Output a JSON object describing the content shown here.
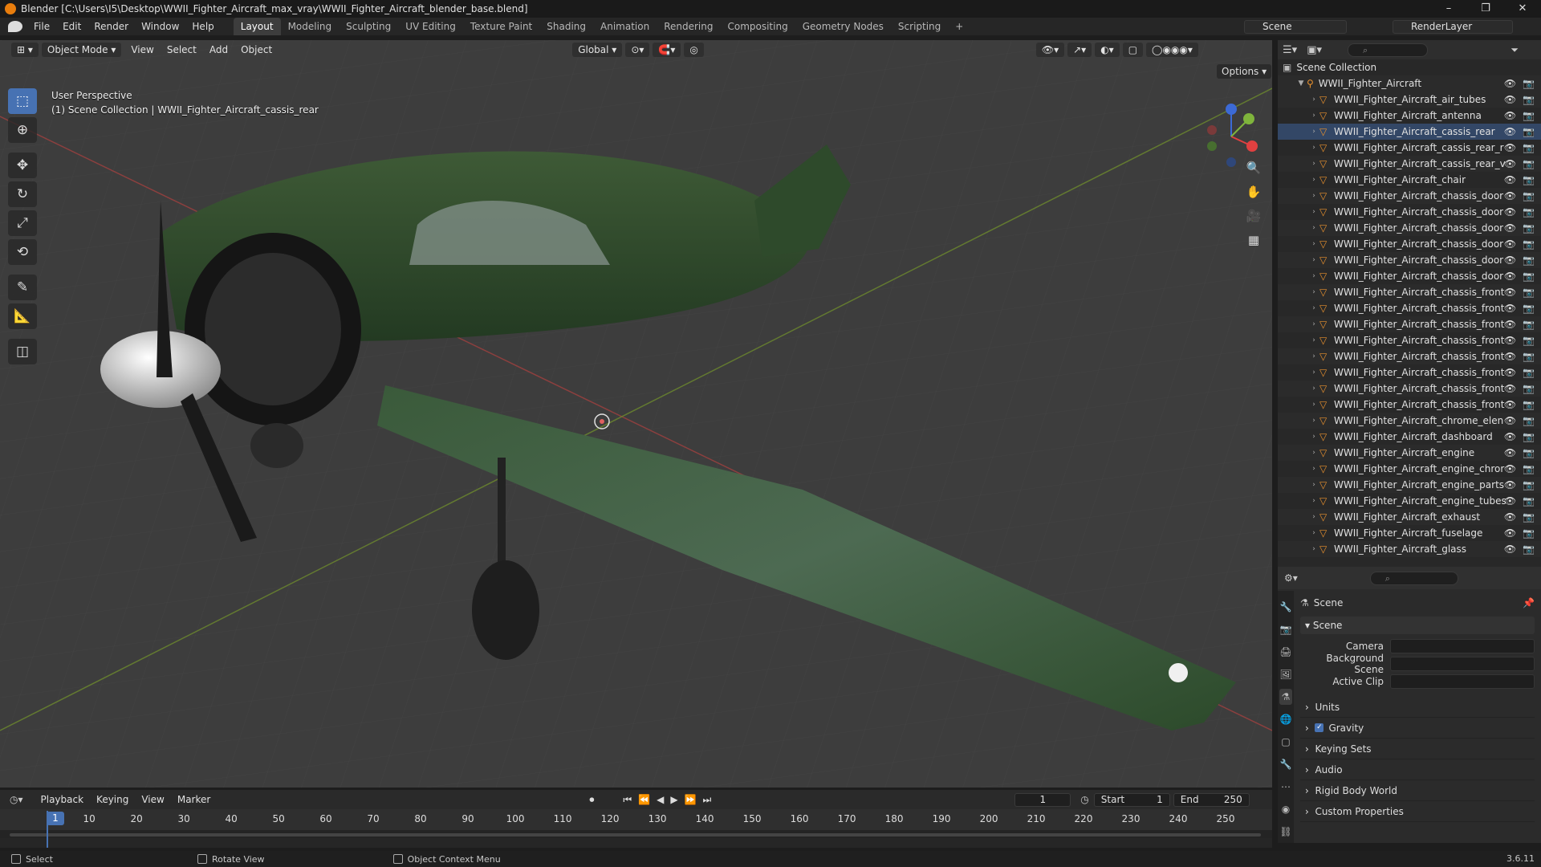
{
  "window": {
    "title": "Blender [C:\\Users\\I5\\Desktop\\WWII_Fighter_Aircraft_max_vray\\WWII_Fighter_Aircraft_blender_base.blend]",
    "minimize": "–",
    "maximize": "❐",
    "close": "✕"
  },
  "menu": {
    "items": [
      "File",
      "Edit",
      "Render",
      "Window",
      "Help"
    ],
    "workspaces": [
      "Layout",
      "Modeling",
      "Sculpting",
      "UV Editing",
      "Texture Paint",
      "Shading",
      "Animation",
      "Rendering",
      "Compositing",
      "Geometry Nodes",
      "Scripting"
    ],
    "add_tab": "+",
    "scene": "Scene",
    "render_layer": "RenderLayer"
  },
  "viewport_header": {
    "mode": "Object Mode",
    "menus": [
      "View",
      "Select",
      "Add",
      "Object"
    ],
    "transform_orientation": "Global",
    "options": "Options"
  },
  "viewport": {
    "perspective": "User Perspective",
    "collection_info": "(1) Scene Collection | WWII_Fighter_Aircraft_cassis_rear",
    "gizmo_axes": [
      "X",
      "Y",
      "Z"
    ]
  },
  "toolbar": {
    "tools": [
      {
        "name": "select-box-tool",
        "glyph": "⬚",
        "active": true
      },
      {
        "name": "cursor-tool",
        "glyph": "⊕",
        "active": false
      },
      {
        "name": "move-tool",
        "glyph": "✥",
        "active": false
      },
      {
        "name": "rotate-tool",
        "glyph": "↻",
        "active": false
      },
      {
        "name": "scale-tool",
        "glyph": "⤢",
        "active": false
      },
      {
        "name": "transform-tool",
        "glyph": "⟲",
        "active": false
      },
      {
        "name": "annotate-tool",
        "glyph": "✎",
        "active": false
      },
      {
        "name": "measure-tool",
        "glyph": "📐",
        "active": false
      },
      {
        "name": "add-cube-tool",
        "glyph": "◫",
        "active": false
      }
    ]
  },
  "outliner": {
    "root": "Scene Collection",
    "collection": "WWII_Fighter_Aircraft",
    "items": [
      "WWII_Fighter_Aircraft_air_tubes",
      "WWII_Fighter_Aircraft_antenna",
      "WWII_Fighter_Aircraft_cassis_rear",
      "WWII_Fighter_Aircraft_cassis_rear_r",
      "WWII_Fighter_Aircraft_cassis_rear_v",
      "WWII_Fighter_Aircraft_chair",
      "WWII_Fighter_Aircraft_chassis_door",
      "WWII_Fighter_Aircraft_chassis_door",
      "WWII_Fighter_Aircraft_chassis_door",
      "WWII_Fighter_Aircraft_chassis_door",
      "WWII_Fighter_Aircraft_chassis_door",
      "WWII_Fighter_Aircraft_chassis_door",
      "WWII_Fighter_Aircraft_chassis_front",
      "WWII_Fighter_Aircraft_chassis_front",
      "WWII_Fighter_Aircraft_chassis_front",
      "WWII_Fighter_Aircraft_chassis_front",
      "WWII_Fighter_Aircraft_chassis_front",
      "WWII_Fighter_Aircraft_chassis_front",
      "WWII_Fighter_Aircraft_chassis_front",
      "WWII_Fighter_Aircraft_chassis_front",
      "WWII_Fighter_Aircraft_chrome_elen",
      "WWII_Fighter_Aircraft_dashboard",
      "WWII_Fighter_Aircraft_engine",
      "WWII_Fighter_Aircraft_engine_chror",
      "WWII_Fighter_Aircraft_engine_parts",
      "WWII_Fighter_Aircraft_engine_tubes",
      "WWII_Fighter_Aircraft_exhaust",
      "WWII_Fighter_Aircraft_fuselage",
      "WWII_Fighter_Aircraft_glass"
    ]
  },
  "properties": {
    "context": "Scene",
    "panel": "Scene",
    "fields": [
      {
        "label": "Camera"
      },
      {
        "label": "Background Scene"
      },
      {
        "label": "Active Clip"
      }
    ],
    "collapsed_panels": [
      "Units",
      "Gravity",
      "Keying Sets",
      "Audio",
      "Rigid Body World",
      "Custom Properties"
    ]
  },
  "timeline": {
    "menus": [
      "Playback",
      "Keying",
      "View",
      "Marker"
    ],
    "current_frame": "1",
    "start_label": "Start",
    "start": "1",
    "end_label": "End",
    "end": "250",
    "ticks": [
      "10",
      "20",
      "30",
      "40",
      "50",
      "60",
      "70",
      "80",
      "90",
      "100",
      "110",
      "120",
      "130",
      "140",
      "150",
      "160",
      "170",
      "180",
      "190",
      "200",
      "210",
      "220",
      "230",
      "240",
      "250"
    ]
  },
  "status": {
    "select": "Select",
    "rotate": "Rotate View",
    "context_menu": "Object Context Menu",
    "version": "3.6.11"
  },
  "colors": {
    "accent": "#4772b3",
    "mesh_icon": "#e8912e",
    "aircraft_green": "#2c4a2a"
  }
}
